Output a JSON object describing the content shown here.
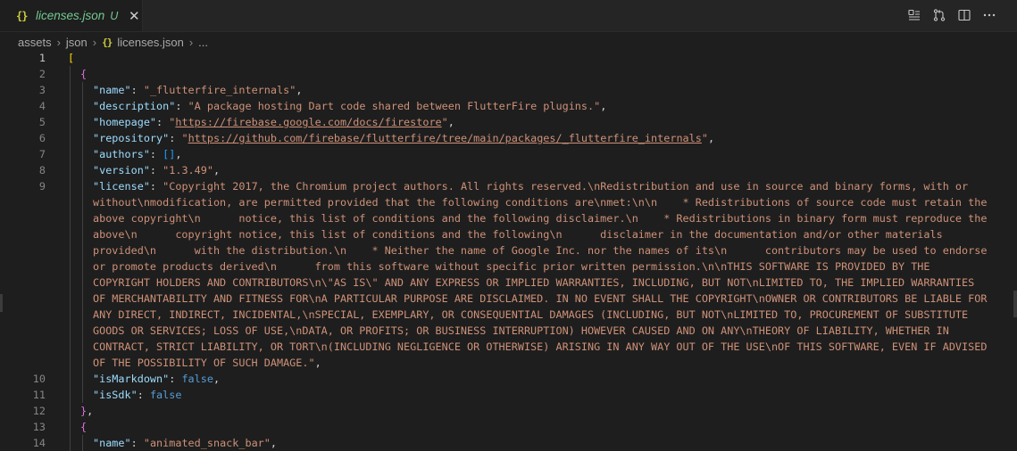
{
  "tab": {
    "filename": "licenses.json",
    "status": "U",
    "icon": "json-icon",
    "close": "✕"
  },
  "actions": [
    "compare-changes-icon",
    "git-timeline-icon",
    "split-editor-icon",
    "more-actions-icon"
  ],
  "breadcrumb": {
    "parts": [
      "assets",
      "json",
      "licenses.json",
      "..."
    ]
  },
  "editor": {
    "active_line": 1,
    "line_numbers": [
      "1",
      "2",
      "3",
      "4",
      "5",
      "6",
      "7",
      "8",
      "9",
      "10",
      "11",
      "12",
      "13",
      "14"
    ],
    "lines": {
      "l1": "[",
      "l2": "{",
      "name_key": "\"name\"",
      "name_val": "\"_flutterfire_internals\"",
      "desc_key": "\"description\"",
      "desc_val": "\"A package hosting Dart code shared between FlutterFire plugins.\"",
      "home_key": "\"homepage\"",
      "home_q1": "\"",
      "home_url": "https://firebase.google.com/docs/firestore",
      "home_q2": "\"",
      "repo_key": "\"repository\"",
      "repo_q1": "\"",
      "repo_url": "https://github.com/firebase/flutterfire/tree/main/packages/_flutterfire_internals",
      "repo_q2": "\"",
      "authors_key": "\"authors\"",
      "authors_val": "[]",
      "version_key": "\"version\"",
      "version_val": "\"1.3.49\"",
      "license_key": "\"license\"",
      "license_wrapped": [
        "\"Copyright 2017, the Chromium project authors. All rights reserved.\\nRedistribution and use in source and binary forms, with or",
        "without\\nmodification, are permitted provided that the following conditions are\\nmet:\\n\\n    * Redistributions of source code must retain the",
        "above copyright\\n      notice, this list of conditions and the following disclaimer.\\n    * Redistributions in binary form must reproduce the",
        "above\\n      copyright notice, this list of conditions and the following\\n      disclaimer in the documentation and/or other materials",
        "provided\\n      with the distribution.\\n    * Neither the name of Google Inc. nor the names of its\\n      contributors may be used to endorse",
        "or promote products derived\\n      from this software without specific prior written permission.\\n\\nTHIS SOFTWARE IS PROVIDED BY THE",
        "COPYRIGHT HOLDERS AND CONTRIBUTORS\\n\\\"AS IS\\\" AND ANY EXPRESS OR IMPLIED WARRANTIES, INCLUDING, BUT NOT\\nLIMITED TO, THE IMPLIED WARRANTIES",
        "OF MERCHANTABILITY AND FITNESS FOR\\nA PARTICULAR PURPOSE ARE DISCLAIMED. IN NO EVENT SHALL THE COPYRIGHT\\nOWNER OR CONTRIBUTORS BE LIABLE FOR",
        "ANY DIRECT, INDIRECT, INCIDENTAL,\\nSPECIAL, EXEMPLARY, OR CONSEQUENTIAL DAMAGES (INCLUDING, BUT NOT\\nLIMITED TO, PROCUREMENT OF SUBSTITUTE",
        "GOODS OR SERVICES; LOSS OF USE,\\nDATA, OR PROFITS; OR BUSINESS INTERRUPTION) HOWEVER CAUSED AND ON ANY\\nTHEORY OF LIABILITY, WHETHER IN",
        "CONTRACT, STRICT LIABILITY, OR TORT\\n(INCLUDING NEGLIGENCE OR OTHERWISE) ARISING IN ANY WAY OUT OF THE USE\\nOF THIS SOFTWARE, EVEN IF ADVISED",
        "OF THE POSSIBILITY OF SUCH DAMAGE.\""
      ],
      "ismd_key": "\"isMarkdown\"",
      "ismd_val": "false",
      "issdk_key": "\"isSdk\"",
      "issdk_val": "false",
      "l12": "},",
      "l13": "{",
      "name2_key": "\"name\"",
      "name2_val": "\"animated_snack_bar\""
    }
  }
}
